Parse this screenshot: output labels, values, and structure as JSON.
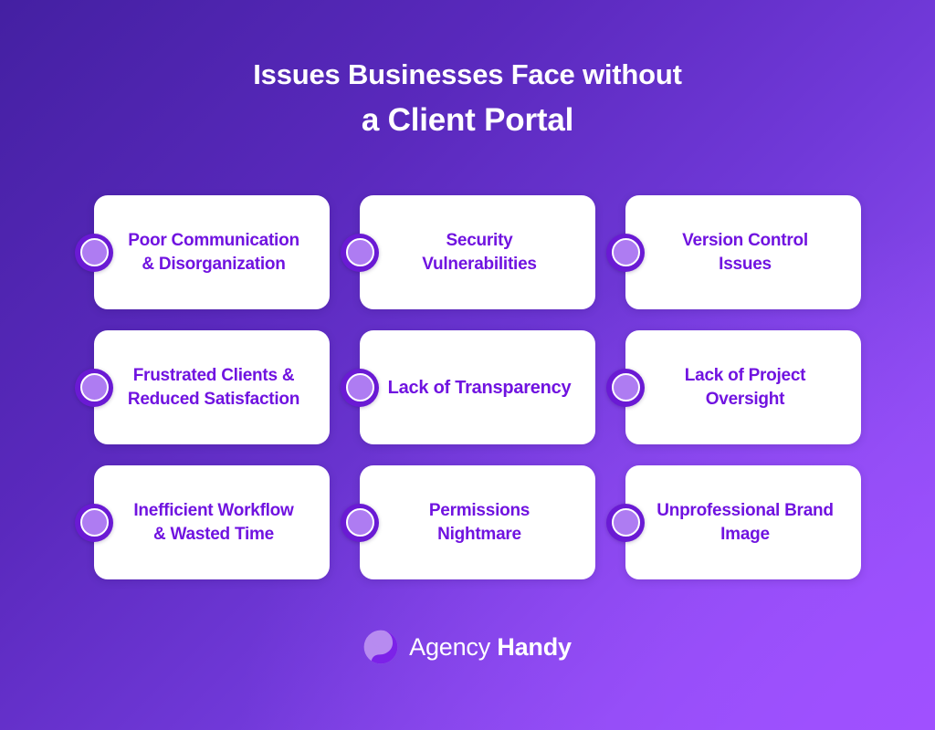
{
  "background": {
    "gradient_from": "#4420a2",
    "gradient_mid": "#7139d9",
    "gradient_to": "#9b55ff"
  },
  "header": {
    "title_line_1": "Issues Businesses Face without",
    "title_line_2": "a Client Portal",
    "title_color": "#ffffff"
  },
  "theme": {
    "card_background": "#ffffff",
    "card_text_color": "#7013e0",
    "badge_outer_color": "#6a1ad4",
    "badge_inner_color": "#ae7cf2",
    "badge_ring_color": "#ffffff"
  },
  "cards": [
    {
      "label": "Poor Communication\n& Disorganization",
      "badge": "bullet-circle-icon"
    },
    {
      "label": "Security\nVulnerabilities",
      "badge": "bullet-circle-icon"
    },
    {
      "label": "Version Control\nIssues",
      "badge": "bullet-circle-icon"
    },
    {
      "label": "Frustrated Clients &\nReduced Satisfaction",
      "badge": "bullet-circle-icon"
    },
    {
      "label": "Lack of Transparency",
      "badge": "bullet-circle-icon"
    },
    {
      "label": "Lack of Project\nOversight",
      "badge": "bullet-circle-icon"
    },
    {
      "label": "Inefficient Workflow\n& Wasted Time",
      "badge": "bullet-circle-icon"
    },
    {
      "label": "Permissions\nNightmare",
      "badge": "bullet-circle-icon"
    },
    {
      "label": "Unprofessional Brand\nImage",
      "badge": "bullet-circle-icon"
    }
  ],
  "footer": {
    "brand_name_light": "Agency",
    "brand_name_bold": "Handy",
    "logo_icon": "agency-handy-swirl-logo",
    "logo_color_dark": "#7c22e8",
    "logo_color_light": "#b78bf0"
  }
}
